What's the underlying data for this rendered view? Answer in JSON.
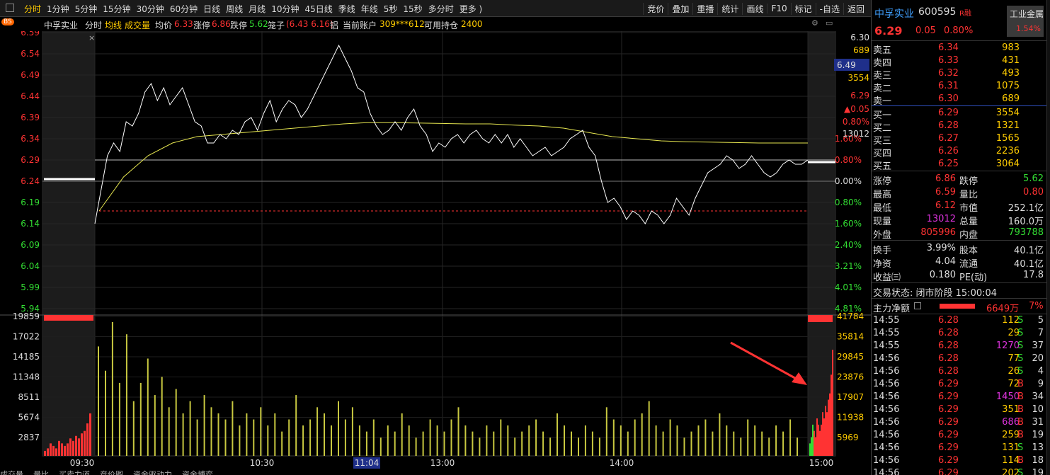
{
  "toolbar": {
    "periods": [
      "分时",
      "1分钟",
      "5分钟",
      "15分钟",
      "30分钟",
      "60分钟",
      "日线",
      "周线",
      "月线",
      "10分钟",
      "45日线",
      "季线",
      "年线",
      "5秒",
      "15秒",
      "多分时",
      "更多 )"
    ],
    "active_period": 0,
    "tools": [
      "竞价",
      "叠加",
      "重播",
      "统计",
      "画线",
      "F10",
      "标记",
      "-自选",
      "返回"
    ]
  },
  "infoline": {
    "name": "中孚实业",
    "mode": "分时",
    "avg_label": "均线",
    "vol_label": "成交量",
    "avg_price_label": "均价",
    "avg_price": "6.33",
    "limit_up_label": "涨停",
    "limit_up": "6.86",
    "limit_down_label": "跌停",
    "limit_down": "5.62",
    "cage_label": "笼子",
    "cage_value": "(6.43 6.16)",
    "sector": "铝",
    "account_label": "当前账户",
    "account": "309***612",
    "hold_label": "可用持仓",
    "hold": "2400",
    "bs_badge": "BS"
  },
  "chart_data": {
    "type": "line",
    "title": "",
    "prev_close": 6.24,
    "y_ticks": [
      "6.59",
      "6.54",
      "6.49",
      "6.44",
      "6.39",
      "6.34",
      "6.29",
      "6.24",
      "6.19",
      "6.14",
      "6.09",
      "6.04",
      "5.99",
      "5.94"
    ],
    "pct_ticks": [
      "1.60%",
      "0.80%",
      "0.00%",
      "0.80%",
      "1.60%",
      "2.40%",
      "3.21%",
      "4.01%",
      "4.81%"
    ],
    "vol_ticks": [
      "19859",
      "17022",
      "14185",
      "11348",
      "8511",
      "5674",
      "2837"
    ],
    "auction_vol_ticks": [
      "41784",
      "35814",
      "29845",
      "23876",
      "17907",
      "11938",
      "5969"
    ],
    "x_ticks": [
      "09:30",
      "10:30",
      "11:04",
      "13:00",
      "14:00",
      "15:00"
    ],
    "right_labels": {
      "open_price": "6.30",
      "open_vol": "689",
      "cursor_price": "6.49",
      "bid_vol": "3554",
      "close_price": "6.29",
      "change": "▲0.05",
      "change_pct": "0.80%",
      "close_vol": "13012"
    },
    "series": [
      {
        "name": "价格",
        "color": "#ffffff",
        "values": [
          6.14,
          6.22,
          6.3,
          6.33,
          6.31,
          6.38,
          6.37,
          6.4,
          6.45,
          6.47,
          6.43,
          6.46,
          6.42,
          6.44,
          6.46,
          6.42,
          6.38,
          6.37,
          6.33,
          6.33,
          6.35,
          6.34,
          6.36,
          6.35,
          6.38,
          6.39,
          6.36,
          6.4,
          6.43,
          6.38,
          6.41,
          6.43,
          6.42,
          6.39,
          6.41,
          6.44,
          6.47,
          6.5,
          6.53,
          6.56,
          6.53,
          6.5,
          6.46,
          6.45,
          6.4,
          6.37,
          6.35,
          6.36,
          6.38,
          6.36,
          6.39,
          6.41,
          6.37,
          6.35,
          6.31,
          6.33,
          6.32,
          6.34,
          6.35,
          6.33,
          6.35,
          6.36,
          6.34,
          6.33,
          6.35,
          6.33,
          6.35,
          6.32,
          6.34,
          6.32,
          6.3,
          6.31,
          6.32,
          6.3,
          6.31,
          6.32,
          6.34,
          6.35,
          6.36,
          6.32,
          6.3,
          6.24,
          6.19,
          6.2,
          6.18,
          6.15,
          6.17,
          6.16,
          6.14,
          6.17,
          6.16,
          6.14,
          6.16,
          6.2,
          6.18,
          6.16,
          6.2,
          6.23,
          6.26,
          6.27,
          6.28,
          6.3,
          6.29,
          6.27,
          6.28,
          6.3,
          6.28,
          6.26,
          6.25,
          6.26,
          6.28,
          6.29,
          6.28,
          6.28,
          6.29
        ]
      },
      {
        "name": "均价",
        "color": "#e6e650",
        "values": [
          6.17,
          6.25,
          6.3,
          6.33,
          6.345,
          6.35,
          6.355,
          6.36,
          6.365,
          6.37,
          6.375,
          6.378,
          6.378,
          6.377,
          6.376,
          6.375,
          6.375,
          6.372,
          6.37,
          6.365,
          6.355,
          6.345,
          6.34,
          6.335,
          6.333,
          6.332,
          6.331,
          6.33,
          6.33,
          6.33
        ]
      }
    ],
    "volume": [
      18,
      14,
      22,
      12,
      20,
      9,
      12,
      16,
      10,
      13,
      8,
      11,
      7,
      9,
      6,
      10,
      8,
      7,
      6,
      9,
      5,
      7,
      6,
      8,
      5,
      7,
      4,
      6,
      10,
      5,
      6,
      8,
      7,
      5,
      9,
      6,
      8,
      5,
      4,
      6,
      3,
      5,
      4,
      7,
      5,
      3,
      4,
      6,
      5,
      4,
      6,
      8,
      5,
      4,
      3,
      5,
      4,
      6,
      5,
      3,
      4,
      5,
      6,
      4,
      3,
      7,
      5,
      4,
      3,
      5,
      4,
      3,
      8,
      6,
      5,
      4,
      6,
      7,
      9,
      5,
      4,
      6,
      5,
      3,
      4,
      5,
      6,
      4,
      7,
      5,
      4,
      3,
      6,
      5,
      4,
      3,
      5,
      4,
      6,
      3
    ],
    "auction_volume": [
      2,
      3,
      5,
      4,
      3,
      6,
      5,
      4,
      5,
      7,
      6,
      8,
      7,
      9,
      10,
      13,
      17
    ]
  },
  "quote": {
    "name": "中孚实业",
    "code": "600595",
    "rz": "R融",
    "price": "6.29",
    "change": "0.05",
    "change_pct": "0.80%",
    "industry": "工业金属",
    "industry_pct": "1.54%"
  },
  "asks": [
    {
      "label": "卖五",
      "price": "6.34",
      "vol": "983"
    },
    {
      "label": "卖四",
      "price": "6.33",
      "vol": "431"
    },
    {
      "label": "卖三",
      "price": "6.32",
      "vol": "493"
    },
    {
      "label": "卖二",
      "price": "6.31",
      "vol": "1075"
    },
    {
      "label": "卖一",
      "price": "6.30",
      "vol": "689"
    }
  ],
  "bids": [
    {
      "label": "买一",
      "price": "6.29",
      "vol": "3554"
    },
    {
      "label": "买二",
      "price": "6.28",
      "vol": "1321"
    },
    {
      "label": "买三",
      "price": "6.27",
      "vol": "1565"
    },
    {
      "label": "买四",
      "price": "6.26",
      "vol": "2236"
    },
    {
      "label": "买五",
      "price": "6.25",
      "vol": "3064"
    }
  ],
  "stats1": [
    {
      "l1": "涨停",
      "v1": "6.86",
      "c1": "#ff3333",
      "l2": "跌停",
      "v2": "5.62",
      "c2": "#33dd33"
    },
    {
      "l1": "最高",
      "v1": "6.59",
      "c1": "#ff3333",
      "l2": "量比",
      "v2": "0.80",
      "c2": "#ff3333"
    },
    {
      "l1": "最低",
      "v1": "6.12",
      "c1": "#ff3333",
      "l2": "市值",
      "v2": "252.1亿",
      "c2": "#dddddd"
    },
    {
      "l1": "现量",
      "v1": "13012",
      "c1": "#dd33dd",
      "l2": "总量",
      "v2": "160.0万",
      "c2": "#dddddd"
    },
    {
      "l1": "外盘",
      "v1": "805996",
      "c1": "#ff3333",
      "l2": "内盘",
      "v2": "793788",
      "c2": "#33dd33"
    }
  ],
  "stats2": [
    {
      "l1": "换手",
      "v1": "3.99%",
      "c1": "#dddddd",
      "l2": "股本",
      "v2": "40.1亿",
      "c2": "#dddddd"
    },
    {
      "l1": "净资",
      "v1": "4.04",
      "c1": "#dddddd",
      "l2": "流通",
      "v2": "40.1亿",
      "c2": "#dddddd"
    },
    {
      "l1": "收益㈢",
      "v1": "0.180",
      "c1": "#dddddd",
      "l2": "PE(动)",
      "v2": "17.8",
      "c2": "#dddddd"
    }
  ],
  "status": "交易状态: 闭市阶段 15:00:04",
  "flow": {
    "label": "主力净额",
    "value": "6649万",
    "pct": "7%"
  },
  "ticks": [
    {
      "t": "14:55",
      "p": "6.28",
      "v": "112",
      "vc": "#ffcc00",
      "d": "S",
      "n": "5"
    },
    {
      "t": "14:55",
      "p": "6.28",
      "v": "29",
      "vc": "#ffcc00",
      "d": "S",
      "n": "7"
    },
    {
      "t": "14:55",
      "p": "6.28",
      "v": "1270",
      "vc": "#dd33dd",
      "d": "S",
      "n": "37"
    },
    {
      "t": "14:56",
      "p": "6.28",
      "v": "77",
      "vc": "#ffcc00",
      "d": "S",
      "n": "20"
    },
    {
      "t": "14:56",
      "p": "6.28",
      "v": "26",
      "vc": "#ffcc00",
      "d": "S",
      "n": "4"
    },
    {
      "t": "14:56",
      "p": "6.29",
      "v": "72",
      "vc": "#ffcc00",
      "d": "B",
      "n": "9"
    },
    {
      "t": "14:56",
      "p": "6.29",
      "v": "1450",
      "vc": "#dd33dd",
      "d": "B",
      "n": "34"
    },
    {
      "t": "14:56",
      "p": "6.29",
      "v": "351",
      "vc": "#ffcc00",
      "d": "B",
      "n": "10"
    },
    {
      "t": "14:56",
      "p": "6.29",
      "v": "686",
      "vc": "#dd33dd",
      "d": "B",
      "n": "31"
    },
    {
      "t": "14:56",
      "p": "6.29",
      "v": "259",
      "vc": "#ffcc00",
      "d": "B",
      "n": "19"
    },
    {
      "t": "14:56",
      "p": "6.29",
      "v": "131",
      "vc": "#ffcc00",
      "d": "S",
      "n": "13"
    },
    {
      "t": "14:56",
      "p": "6.29",
      "v": "114",
      "vc": "#ffcc00",
      "d": "B",
      "n": "18"
    },
    {
      "t": "14:56",
      "p": "6.29",
      "v": "202",
      "vc": "#ffcc00",
      "d": "S",
      "n": "19"
    }
  ],
  "bottom_tabs": [
    "成交量",
    "量比",
    "买卖力道",
    "竞价图",
    "资金驱动力",
    "资金博弈"
  ],
  "colors": {
    "up": "#ff3333",
    "down": "#33dd33",
    "price_line": "#ffffff",
    "avg_line": "#e6e650",
    "grid": "#2a2a2a",
    "bg": "#000000"
  }
}
